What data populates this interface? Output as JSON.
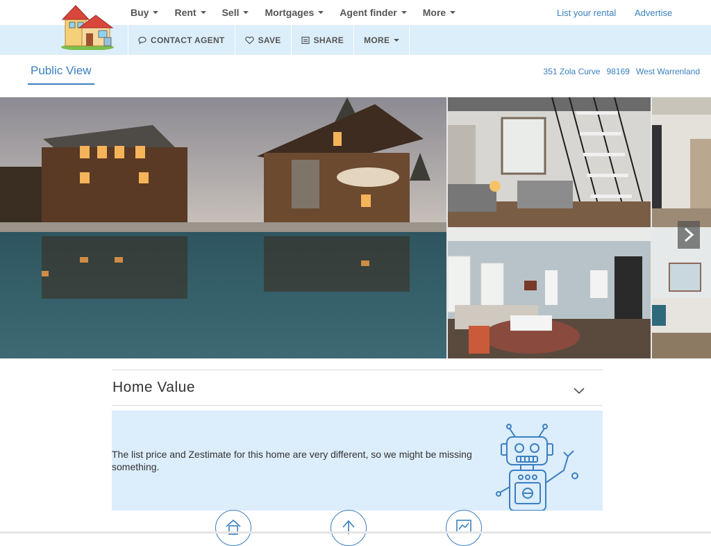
{
  "nav": {
    "items": [
      {
        "label": "Buy"
      },
      {
        "label": "Rent"
      },
      {
        "label": "Sell"
      },
      {
        "label": "Mortgages"
      },
      {
        "label": "Agent finder"
      },
      {
        "label": "More"
      }
    ],
    "list_rental": "List your rental",
    "advertise": "Advertise"
  },
  "actions": {
    "contact": "CONTACT AGENT",
    "save": "SAVE",
    "share": "SHARE",
    "more": "MORE"
  },
  "tab": {
    "public_view": "Public View"
  },
  "address": {
    "street": "351 Zola Curve",
    "zip": "98169",
    "city": "West Warrenland"
  },
  "home_value": {
    "title": "Home Value",
    "message": "The list price and Zestimate for this home are very different, so we might be missing something."
  },
  "colors": {
    "accent": "#3a7fc1",
    "actionbar": "#dbeefa",
    "panel": "#dcedfb"
  },
  "icons": {
    "contact": "chat-bubble-icon",
    "save": "heart-icon",
    "share": "share-box-icon",
    "next": "chevron-right-icon",
    "collapse": "chevron-down-icon",
    "robot": "robot-illustration",
    "circles": [
      "home-icon",
      "upload-arrow-icon",
      "chart-icon"
    ]
  }
}
